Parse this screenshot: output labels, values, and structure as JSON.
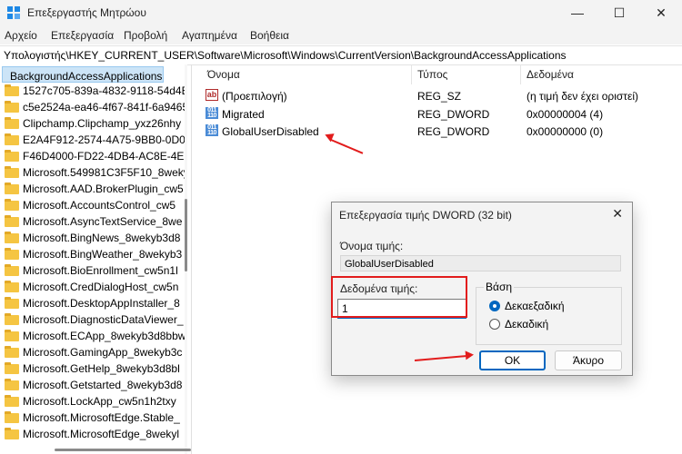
{
  "window": {
    "title": "Επεξεργαστής Μητρώου",
    "min_glyph": "—",
    "max_glyph": "☐",
    "close_glyph": "✕"
  },
  "menu": [
    "Αρχείο",
    "Επεξεργασία",
    "Προβολή",
    "Αγαπημένα",
    "Βοήθεια"
  ],
  "address": "Υπολογιστής\\HKEY_CURRENT_USER\\Software\\Microsoft\\Windows\\CurrentVersion\\BackgroundAccessApplications",
  "tree": {
    "selected": "BackgroundAccessApplications",
    "items": [
      "1527c705-839a-4832-9118-54d4B",
      "c5e2524a-ea46-4f67-841f-6a9465",
      "Clipchamp.Clipchamp_yxz26nhy",
      "E2A4F912-2574-4A75-9BB0-0D02",
      "F46D4000-FD22-4DB4-AC8E-4E1I",
      "Microsoft.549981C3F5F10_8weky",
      "Microsoft.AAD.BrokerPlugin_cw5",
      "Microsoft.AccountsControl_cw5",
      "Microsoft.AsyncTextService_8we",
      "Microsoft.BingNews_8wekyb3d8",
      "Microsoft.BingWeather_8wekyb3",
      "Microsoft.BioEnrollment_cw5n1l",
      "Microsoft.CredDialogHost_cw5n",
      "Microsoft.DesktopAppInstaller_8",
      "Microsoft.DiagnosticDataViewer_",
      "Microsoft.ECApp_8wekyb3d8bbw",
      "Microsoft.GamingApp_8wekyb3c",
      "Microsoft.GetHelp_8wekyb3d8bl",
      "Microsoft.Getstarted_8wekyb3d8",
      "Microsoft.LockApp_cw5n1h2txy",
      "Microsoft.MicrosoftEdge.Stable_",
      "Microsoft.MicrosoftEdge_8wekyl"
    ]
  },
  "list": {
    "headers": {
      "name": "Όνομα",
      "type": "Τύπος",
      "data": "Δεδομένα"
    },
    "rows": [
      {
        "icon": "string-value-icon",
        "glyph": "ab",
        "name": "(Προεπιλογή)",
        "type": "REG_SZ",
        "data": "(η τιμή δεν έχει οριστεί)"
      },
      {
        "icon": "dword-value-icon",
        "glyph": "011 110",
        "name": "Migrated",
        "type": "REG_DWORD",
        "data": "0x00000004 (4)"
      },
      {
        "icon": "dword-value-icon",
        "glyph": "011 110",
        "name": "GlobalUserDisabled",
        "type": "REG_DWORD",
        "data": "0x00000000 (0)"
      }
    ]
  },
  "dialog": {
    "title": "Επεξεργασία τιμής DWORD (32 bit)",
    "close_glyph": "✕",
    "name_label": "Όνομα τιμής:",
    "name_value": "GlobalUserDisabled",
    "data_label": "Δεδομένα τιμής:",
    "data_value": "1",
    "base_label": "Βάση",
    "radio_hex": "Δεκαεξαδική",
    "radio_dec": "Δεκαδική",
    "selected_base": "Δεκαεξαδική",
    "ok": "OK",
    "cancel": "Άκυρο"
  },
  "colors": {
    "accent": "#0067c0",
    "annotation_red": "#e21c1c",
    "selection": "#cce4f7"
  }
}
